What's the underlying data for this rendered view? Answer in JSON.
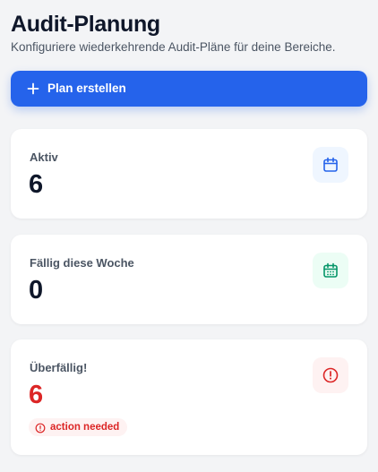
{
  "header": {
    "title": "Audit-Planung",
    "subtitle": "Konfiguriere wiederkehrende Audit-Pläne für deine Bereiche."
  },
  "actions": {
    "create_label": "Plan erstellen",
    "create_icon": "plus-icon"
  },
  "stats": {
    "active": {
      "label": "Aktiv",
      "value": "6",
      "icon": "calendar-icon",
      "accent": "#2563eb"
    },
    "due_this_week": {
      "label": "Fällig diese Woche",
      "value": "0",
      "icon": "calendar-days-icon",
      "accent": "#059669"
    },
    "overdue": {
      "label": "Überfällig!",
      "value": "6",
      "icon": "alert-circle-icon",
      "accent": "#dc2626",
      "badge": "action needed"
    }
  },
  "colors": {
    "primary": "#2563eb",
    "danger": "#dc2626",
    "success": "#059669",
    "background": "#f3f4f6"
  }
}
